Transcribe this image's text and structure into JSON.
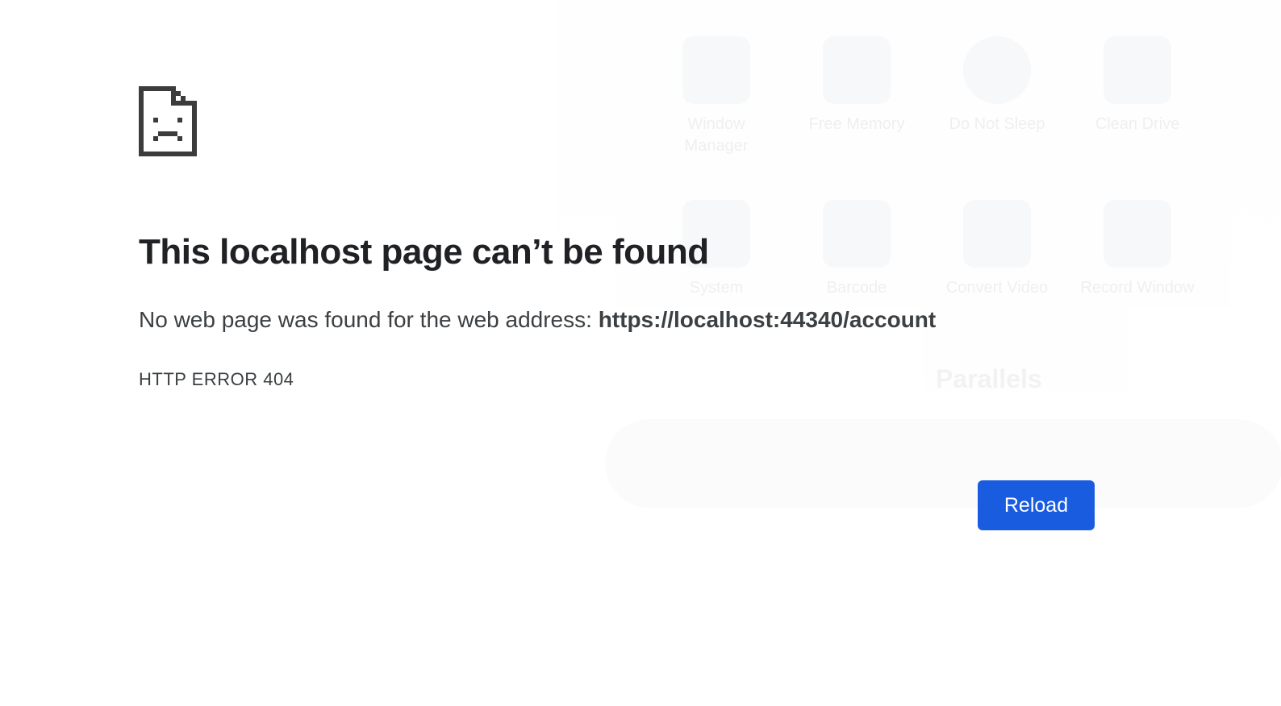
{
  "error_page": {
    "title": "This localhost page can’t be found",
    "message_prefix": "No web page was found for the web address: ",
    "url": "https://localhost:44340/account",
    "error_code": "HTTP ERROR 404",
    "reload_label": "Reload",
    "icon": "sad-document-icon",
    "accent_color": "#1a5ce0"
  },
  "background_overlay": {
    "row1": [
      "Window Manager",
      "Free Memory",
      "Do Not Sleep",
      "Clean Drive"
    ],
    "row2": [
      "System",
      "Barcode",
      "Convert Video",
      "Record Window"
    ],
    "brand": "Parallels"
  }
}
